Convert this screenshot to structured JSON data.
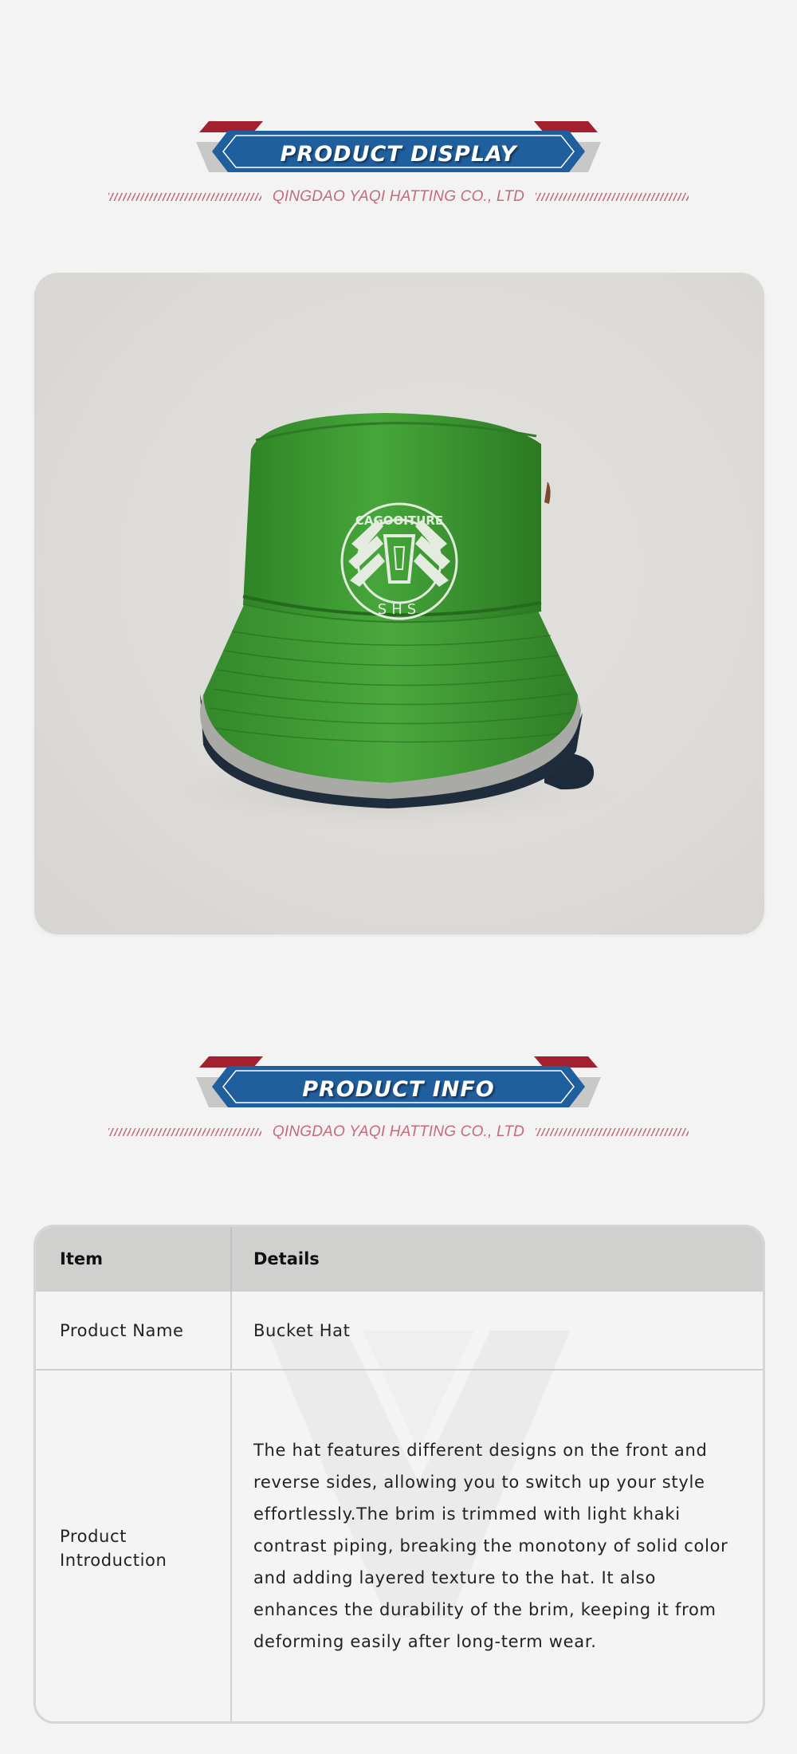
{
  "display_header": {
    "title": "PRODUCT DISPLAY",
    "subtitle": "QINGDAO YAQI HATTING CO., LTD"
  },
  "product_image": {
    "subject": "green bucket hat",
    "logo_text_top": "CAGOOITURE",
    "logo_text_bottom": "SHS"
  },
  "info_header": {
    "title": "PRODUCT INFO",
    "subtitle": "QINGDAO YAQI HATTING CO., LTD"
  },
  "info_table": {
    "headers": [
      "Item",
      "Details"
    ],
    "rows": [
      {
        "item": "Product Name",
        "details": "Bucket Hat"
      },
      {
        "item": "Product Introduction",
        "details": "The hat features different designs on the front and reverse sides, allowing you to switch up your style effortlessly.The brim is trimmed with light khaki contrast piping, breaking the monotony of solid color and adding layered texture to the hat. It also enhances the durability of the brim, keeping it from deforming easily after long-term wear."
      }
    ]
  },
  "colors": {
    "background": "#f3f3f3",
    "banner_blue": "#1f5f9e",
    "banner_red": "#a3202e",
    "banner_gray": "#c8c8c8",
    "subtitle_pink": "#c56a7a",
    "hat_green": "#3f9a33",
    "table_header": "#d0d0cf"
  }
}
